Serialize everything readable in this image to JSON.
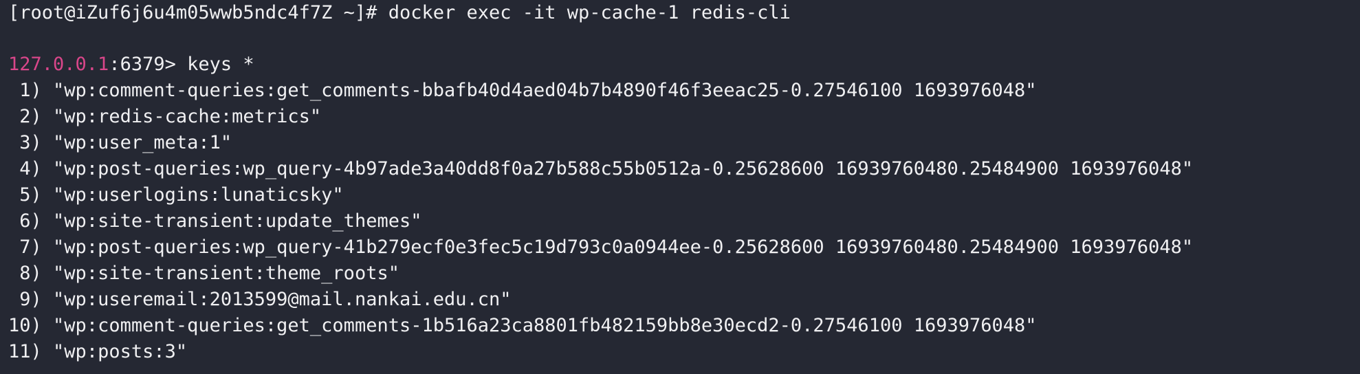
{
  "terminal": {
    "shell_prompt": "[root@iZuf6j6u4m05wwb5ndc4f7Z ~]# ",
    "shell_command": "docker exec -it wp-cache-1 redis-cli",
    "redis_host": "127.0.0.1",
    "redis_port_prompt": ":6379> ",
    "redis_command": "keys *",
    "results": [
      {
        "index": " 1)",
        "value": "\"wp:comment-queries:get_comments-bbafb40d4aed04b7b4890f46f3eeac25-0.27546100 1693976048\""
      },
      {
        "index": " 2)",
        "value": "\"wp:redis-cache:metrics\""
      },
      {
        "index": " 3)",
        "value": "\"wp:user_meta:1\""
      },
      {
        "index": " 4)",
        "value": "\"wp:post-queries:wp_query-4b97ade3a40dd8f0a27b588c55b0512a-0.25628600 16939760480.25484900 1693976048\""
      },
      {
        "index": " 5)",
        "value": "\"wp:userlogins:lunaticsky\""
      },
      {
        "index": " 6)",
        "value": "\"wp:site-transient:update_themes\""
      },
      {
        "index": " 7)",
        "value": "\"wp:post-queries:wp_query-41b279ecf0e3fec5c19d793c0a0944ee-0.25628600 16939760480.25484900 1693976048\""
      },
      {
        "index": " 8)",
        "value": "\"wp:site-transient:theme_roots\""
      },
      {
        "index": " 9)",
        "value": "\"wp:useremail:2013599@mail.nankai.edu.cn\""
      },
      {
        "index": "10)",
        "value": "\"wp:comment-queries:get_comments-1b516a23ca8801fb482159bb8e30ecd2-0.27546100 1693976048\""
      },
      {
        "index": "11)",
        "value": "\"wp:posts:3\""
      }
    ]
  }
}
